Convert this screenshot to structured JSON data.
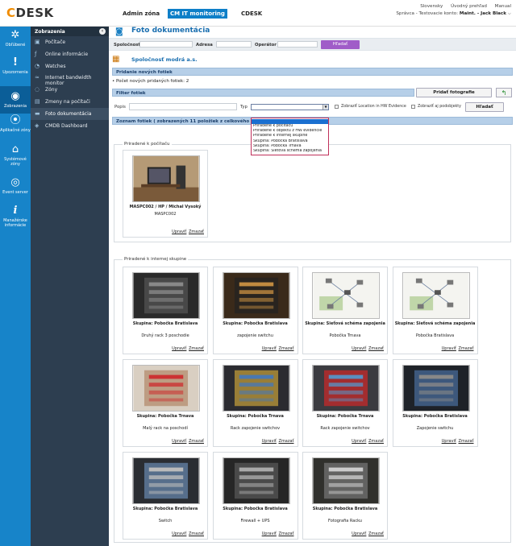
{
  "app": {
    "logo_c": "C",
    "logo_rest": "DESK"
  },
  "topnav": [
    {
      "label": "Admin zóna",
      "active": false
    },
    {
      "label": "CM IT monitoring",
      "active": true
    },
    {
      "label": "CDESK",
      "active": false
    }
  ],
  "topright": {
    "links": [
      "Slovensky",
      "Úvodný prehľad",
      "Manual"
    ],
    "account_prefix": "Správca - Testovacie konto:",
    "account_user": "Maint. - Jack Black",
    "account_chevron": "⌵"
  },
  "iconbar": [
    {
      "label": "Obľúbené",
      "icon": "star-gear-icon",
      "glyph": "✲"
    },
    {
      "label": "Upozornenia",
      "icon": "exclamation-icon",
      "glyph": "!"
    },
    {
      "label": "Zobrazenia",
      "icon": "eye-icon",
      "glyph": "◉"
    },
    {
      "label": "Aplikačné zóny",
      "icon": "app-zone-icon",
      "glyph": "⦿"
    },
    {
      "label": "Systémové zóny",
      "icon": "system-zone-icon",
      "glyph": "⌂"
    },
    {
      "label": "Event server",
      "icon": "event-server-icon",
      "glyph": "◎"
    },
    {
      "label": "Manažérske informácie",
      "icon": "info-icon",
      "glyph": "i"
    }
  ],
  "menu": {
    "title": "Zobrazenia",
    "collapse": "‹",
    "items": [
      {
        "label": "Počítače",
        "icon": "computer-icon",
        "glyph": "▣"
      },
      {
        "label": "Online informácie",
        "icon": "online-icon",
        "glyph": "ƒ"
      },
      {
        "label": "Watches",
        "icon": "watch-icon",
        "glyph": "◔"
      },
      {
        "label": "Internet bandwidth monitor",
        "icon": "bandwidth-icon",
        "glyph": "≈"
      },
      {
        "label": "Zóny",
        "icon": "zone-icon",
        "glyph": "◌"
      },
      {
        "label": "Zmeny na počítači",
        "icon": "changes-icon",
        "glyph": "▤"
      },
      {
        "label": "Foto dokumentácia",
        "icon": "photo-icon",
        "glyph": "▬"
      },
      {
        "label": "CMDB Dashboard",
        "icon": "dashboard-icon",
        "glyph": "◈"
      }
    ]
  },
  "page": {
    "title": "Foto dokumentácia"
  },
  "search": {
    "spolocnost_label": "Spoločnosť",
    "adresa_label": "Adresa",
    "operator_label": "Operátor",
    "button": "Hľadať"
  },
  "company": "Spoločnosť modrá a.s.",
  "new_photos": {
    "bar": "Pridanie nových fotiek",
    "count_label": "Počet nových pridaných fotiek: 2",
    "bullet": "•"
  },
  "filter": {
    "bar": "Filter fotiek",
    "popis_label": "Popis",
    "typ_label": "Typ",
    "typ_arrow": "▼",
    "chk_location": "Zobraziť Location in HW Evidence",
    "chk_similar": "Zobraziť aj podobjekty",
    "search_button": "Hľadať",
    "add_button": "Pridať fotografie",
    "refresh_glyph": "↰",
    "options": [
      "Priradené k počítaču",
      "Priradené k objektu z HW evidencie",
      "Priradené k internej skupine",
      "Skupina: Pobočka Bratislava",
      "Skupina: Pobočka Trnava",
      "Skupina: Sieťová schéma zapojenia"
    ]
  },
  "list_bar": {
    "prefix": "Zoznam fotiek ( zobrazených",
    "shown": "11",
    "middle": "položiek z celkového počtu",
    "total": "11"
  },
  "section1": {
    "title": "Priradené k počítaču",
    "cards": [
      {
        "group": "MASPC002 / HP / Michal Vysoký",
        "desc": "MASPC002",
        "edit": "Upraviť",
        "delete": "Zmazať",
        "img": "computer-photo"
      }
    ]
  },
  "section2": {
    "title": "Priradené k internej skupine",
    "cards": [
      {
        "group": "Skupina: Pobočka Bratislava",
        "desc": "Druhý rack 3 poschodie",
        "edit": "Upraviť",
        "delete": "Zmazať",
        "img": "rack-photo"
      },
      {
        "group": "Skupina: Pobočka Bratislava",
        "desc": "zapojenie switchu",
        "edit": "Upraviť",
        "delete": "Zmazať",
        "img": "switch-photo"
      },
      {
        "group": "Skupina: Sieťová schéma zapojenia",
        "desc": "Pobočka Trnava",
        "edit": "Upraviť",
        "delete": "Zmazať",
        "img": "network-diagram"
      },
      {
        "group": "Skupina: Sieťová schéma zapojenia",
        "desc": "Pobočka Bratislava",
        "edit": "Upraviť",
        "delete": "Zmazať",
        "img": "network-diagram"
      },
      {
        "group": "Skupina: Pobočka Trnava",
        "desc": "Malý rack na poschodí",
        "edit": "Upraviť",
        "delete": "Zmazať",
        "img": "pipes-photo"
      },
      {
        "group": "Skupina: Pobočka Trnava",
        "desc": "Rack zapojenie switchov",
        "edit": "Upraviť",
        "delete": "Zmazať",
        "img": "cabling-photo"
      },
      {
        "group": "Skupina: Pobočka Trnava",
        "desc": "Rack zapojenie switchov",
        "edit": "Upraviť",
        "delete": "Zmazať",
        "img": "patch-photo"
      },
      {
        "group": "Skupina: Pobočka Bratislava",
        "desc": "Zapojenie switchu",
        "edit": "Upraviť",
        "delete": "Zmazať",
        "img": "rack2-photo"
      },
      {
        "group": "Skupina: Pobočka Bratislava",
        "desc": "Switch",
        "edit": "Upraviť",
        "delete": "Zmazať",
        "img": "rack3-photo"
      },
      {
        "group": "Skupina: Pobočka Bratislava",
        "desc": "Firewall + UPS",
        "edit": "Upraviť",
        "delete": "Zmazať",
        "img": "ups-photo"
      },
      {
        "group": "Skupina: Pobočka Bratislava",
        "desc": "Fotografia Racku",
        "edit": "Upraviť",
        "delete": "Zmazať",
        "img": "rack4-photo"
      }
    ]
  }
}
